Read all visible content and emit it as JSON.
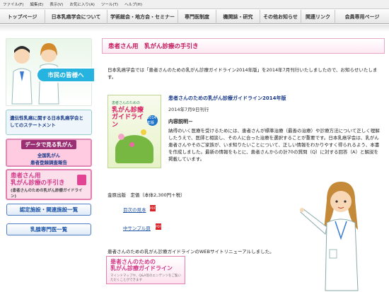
{
  "menubar": {
    "items": [
      "ファイル(F)",
      "編集(E)",
      "表示(V)",
      "お気に入り(A)",
      "ツール(T)",
      "ヘルプ(H)"
    ]
  },
  "topnav": {
    "items": [
      "トップページ",
      "日本乳癌学会について",
      "学術総会・地方会・セミナー",
      "専門医制度",
      "機関誌・研究",
      "その他お知らせ",
      "関連リンク",
      "会員専用ページ"
    ]
  },
  "sidebar": {
    "hero_badge": "市民の皆様へ",
    "statement": "遺伝性乳癌に関する日本乳癌学会としてのステートメント",
    "data_highlight": "データで見る乳がん",
    "data_line1": "全国乳がん",
    "data_line2": "患者登録調査報告",
    "tebiki_line1": "患者さん用",
    "tebiki_line2": "乳がん診療の手引き",
    "tebiki_sub": "(患者さんのための乳がん診療ガイドライン)",
    "link1": "認定施設・関連施設一覧",
    "link2": "乳腺専門医一覧"
  },
  "main": {
    "heading": "患者さん用　乳がん診療の手引き",
    "intro": "日本乳癌学会では「患者さんのための乳がん診療ガイドライン2014年版」を2014年7月刊行いたしましたので、お知らせいたします。",
    "book": {
      "cover_top": "患者さんのための",
      "cover_main": "乳がん診療ガイドライン",
      "cover_year": "2014年版",
      "title": "患者さんのための乳がん診療ガイドライン2014年版",
      "date": "2014年7月9日刊行"
    },
    "desc_heading": "内容説明－",
    "desc_body": "納得のいく医療を受けるためには、患者さんが標準治療（最善の治療）や診療方法について正しく理解したうえで、医師と相談し、その人に合った治療を選択することが重要です。日本乳癌学会は、乳がん患者さんやそのご家族が、いま知りたいことについて、正しい情報をわかりやすく得られるよう、本書を作成しました。最新の情報をもとに、患者さんからの計70の質問（Q）に対する回答（A）と解説を掲載しています。",
    "price": "金原出版　定価（本体2,300円＋税）",
    "link_toc": "目次の見本",
    "link_sample": "中サンプル頁",
    "renewal": "患者さんのための乳がん診療ガイドラインのWEBサイトリニューアルしました。",
    "web_line1": "患者さんのための",
    "web_line2": "乳がん診療ガイドライン",
    "web_sub": "マインドマップや、Q&A等のエンデンツをご覧いただくことができます"
  }
}
